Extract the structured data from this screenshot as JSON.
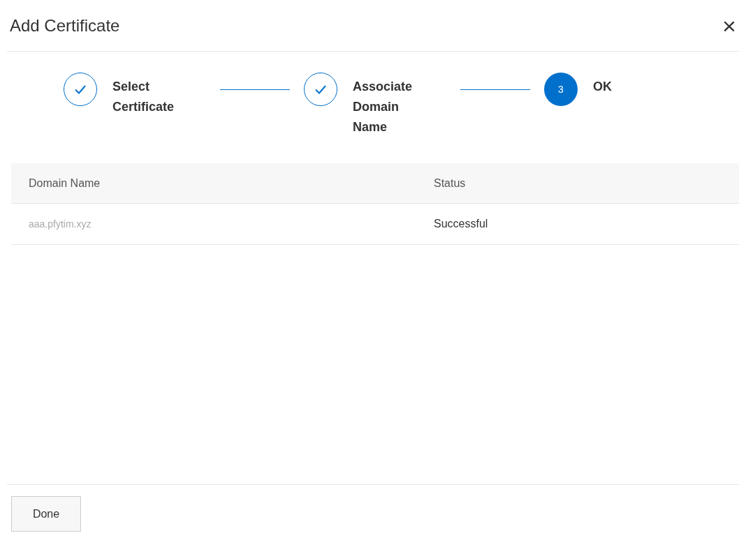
{
  "dialog": {
    "title": "Add Certificate",
    "close": "×"
  },
  "steps": [
    {
      "label": "Select Certificate",
      "kind": "done"
    },
    {
      "label": "Associate Domain Name",
      "kind": "done"
    },
    {
      "label": "OK",
      "kind": "current",
      "number": "3"
    }
  ],
  "table": {
    "columns": [
      "Domain Name",
      "Status"
    ],
    "rows": [
      {
        "cells": [
          "aaa.pfytim.xyz",
          "Successful"
        ]
      }
    ]
  },
  "buttons": [
    {
      "label": "Done"
    }
  ]
}
